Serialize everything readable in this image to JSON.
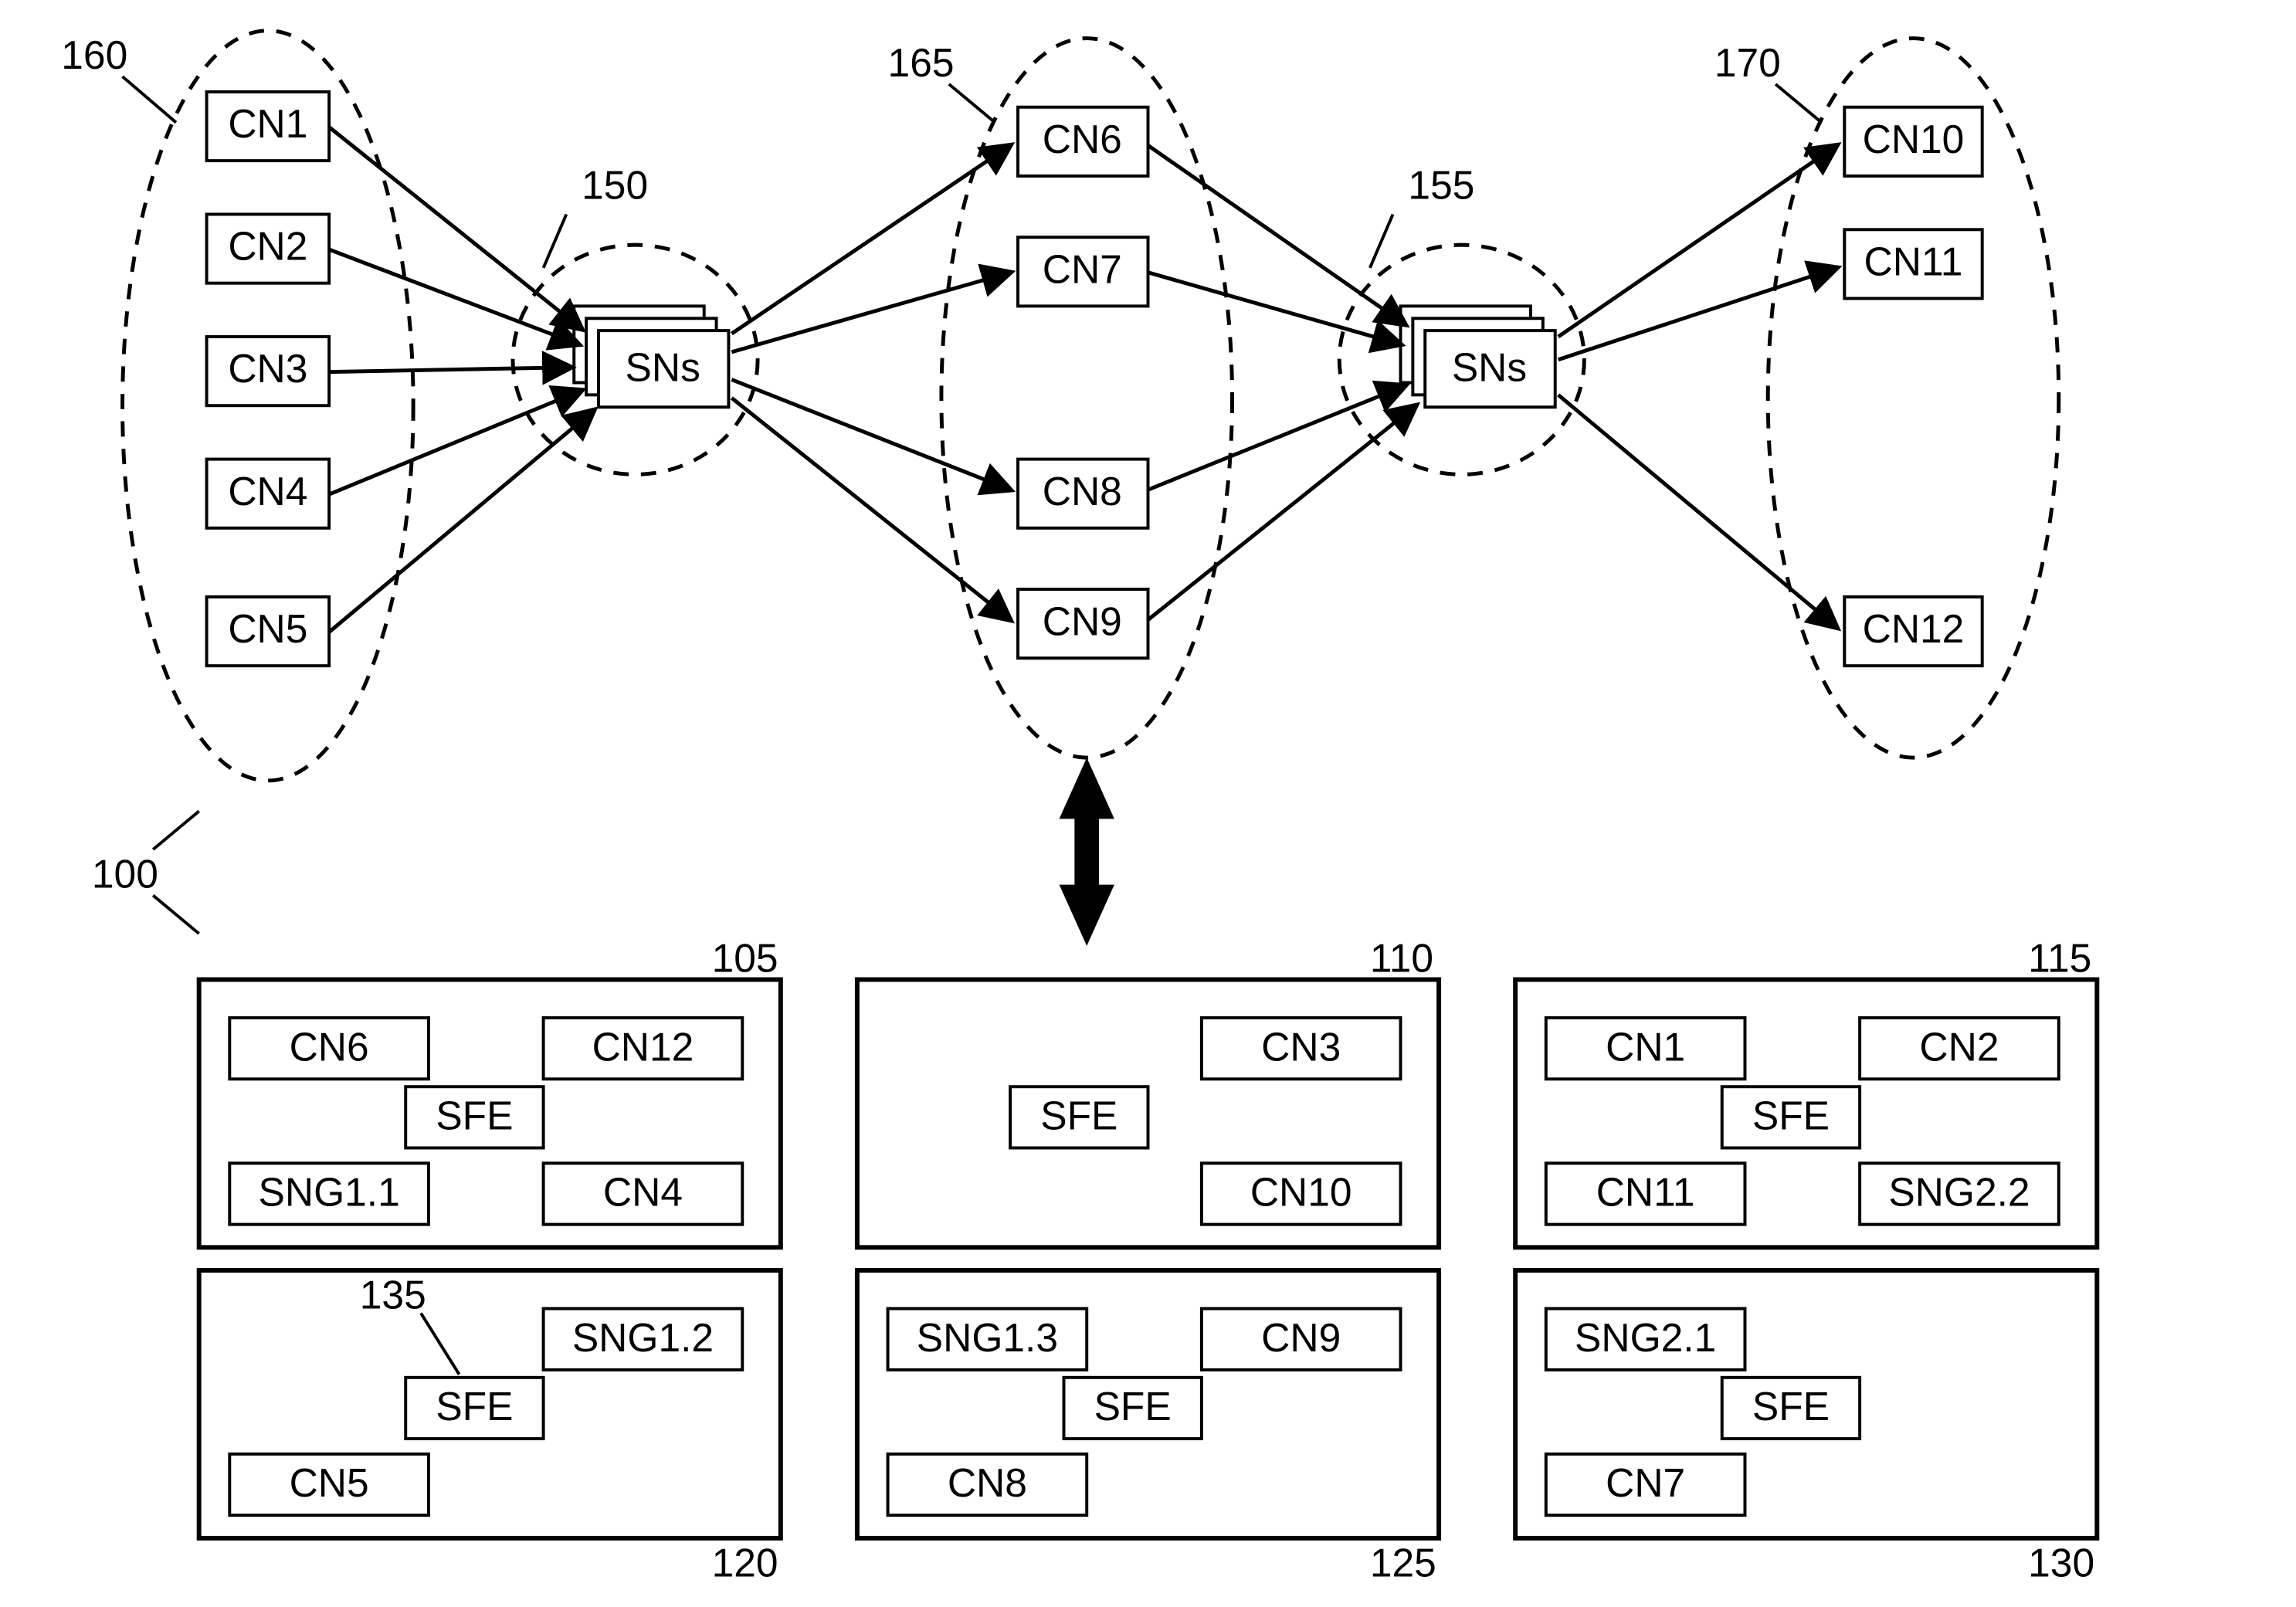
{
  "refs": {
    "r100": "100",
    "r160": "160",
    "r150": "150",
    "r165": "165",
    "r155": "155",
    "r170": "170",
    "r105": "105",
    "r110": "110",
    "r115": "115",
    "r120": "120",
    "r125": "125",
    "r130": "130",
    "r135": "135"
  },
  "top": {
    "sn1": "SNs",
    "sn2": "SNs",
    "cn1": "CN1",
    "cn2": "CN2",
    "cn3": "CN3",
    "cn4": "CN4",
    "cn5": "CN5",
    "cn6": "CN6",
    "cn7": "CN7",
    "cn8": "CN8",
    "cn9": "CN9",
    "cn10": "CN10",
    "cn11": "CN11",
    "cn12": "CN12"
  },
  "hosts": {
    "h105": {
      "sfe": "SFE",
      "a": "CN6",
      "b": "CN12",
      "c": "SNG1.1",
      "d": "CN4"
    },
    "h110": {
      "sfe": "SFE",
      "b": "CN3",
      "d": "CN10"
    },
    "h115": {
      "sfe": "SFE",
      "a": "CN1",
      "b": "CN2",
      "c": "CN11",
      "d": "SNG2.2"
    },
    "h120": {
      "sfe": "SFE",
      "b": "SNG1.2",
      "c": "CN5"
    },
    "h125": {
      "sfe": "SFE",
      "a": "SNG1.3",
      "b": "CN9",
      "c": "CN8"
    },
    "h130": {
      "sfe": "SFE",
      "a": "SNG2.1",
      "c": "CN7"
    }
  }
}
